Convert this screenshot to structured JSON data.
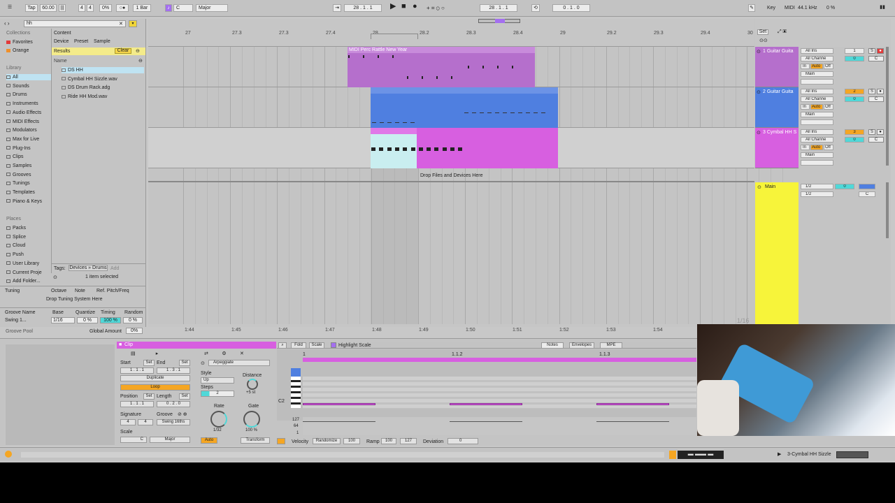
{
  "control_bar": {
    "tap": "Tap",
    "tempo": "60.00",
    "meter_num": "4",
    "meter_den": "4",
    "swing": "0%",
    "quantize": "1 Bar",
    "key": "C",
    "scale": "Major",
    "position": "28 . 1 . 1",
    "loop_start": "28 . 1 . 1",
    "loop_length": "0 . 1 . 0",
    "key_label": "Key",
    "midi_label": "MIDI",
    "sample_rate": "44.1 kHz",
    "cpu": "0 %"
  },
  "browser": {
    "search_value": "hh",
    "content_tab": "Content",
    "filters": [
      "Device",
      "Preset",
      "Sample"
    ],
    "results_label": "Results",
    "clear_label": "Clear",
    "name_col": "Name",
    "collections_label": "Collections",
    "collections": [
      {
        "label": "Favorites",
        "color": "#e23a3a"
      },
      {
        "label": "Orange",
        "color": "#f0902a"
      }
    ],
    "library_label": "Library",
    "library": [
      "All",
      "Sounds",
      "Drums",
      "Instruments",
      "Audio Effects",
      "MIDI Effects",
      "Modulators",
      "Max for Live",
      "Plug-Ins",
      "Clips",
      "Samples",
      "Grooves",
      "Tunings",
      "Templates",
      "Piano & Keys"
    ],
    "places_label": "Places",
    "places": [
      "Packs",
      "Splice",
      "Cloud",
      "Push",
      "User Library",
      "Current Proje",
      "Add Folder..."
    ],
    "results": [
      "DS HH",
      "Cymbal HH Sizzle.wav",
      "DS Drum Rack.adg",
      "Ride HH Mod.wav"
    ],
    "tags_label": "Tags:",
    "tags_value": "Devices » Drums",
    "add_label": "Add",
    "selected_info": "1 item selected",
    "tuning_cols": [
      "Tuning",
      "Octave",
      "Note",
      "Ref. Pitch/Freq"
    ],
    "tuning_drop": "Drop Tuning System Here",
    "groove_cols": [
      "Groove Name",
      "Base",
      "Quantize",
      "Timing",
      "Random"
    ],
    "groove_name": "Swing 1...",
    "groove_base": "1/16",
    "groove_quantize": "0 %",
    "groove_timing": "100 %",
    "groove_random": "0 %",
    "global_amount_label": "Global Amount",
    "global_amount": "0%",
    "groove_pool_label": "Groove Pool"
  },
  "arrangement": {
    "ruler_top": [
      "27",
      "27.3",
      "27.3",
      "27.4",
      "28",
      "28.2",
      "28.3",
      "28.4",
      "29",
      "29.2",
      "29.3",
      "29.4",
      "30"
    ],
    "ruler_bottom": [
      "1:44",
      "1:45",
      "1:46",
      "1:47",
      "1:48",
      "1:49",
      "1:50",
      "1:51",
      "1:52",
      "1:53",
      "1:54"
    ],
    "set_label": "Set",
    "clip1_name": "MIDI Perc Rattle New Year",
    "drop_label": "Drop Files and Devices Here",
    "quantize_hint": "1/16",
    "tracks": [
      {
        "name": "1 Guitar Guita",
        "num": "1",
        "color": "#b56fcc",
        "input": "All Ins",
        "channel": "All Channe",
        "out": "Main",
        "vol": "0",
        "pan": "C",
        "in": "In",
        "auto": "Auto",
        "off": "Off"
      },
      {
        "name": "2 Guitar Guita",
        "num": "2",
        "color": "#4f7fe0",
        "input": "All Ins",
        "channel": "All Channe",
        "out": "Main",
        "vol": "0",
        "pan": "C",
        "in": "In",
        "auto": "Auto",
        "off": "Off"
      },
      {
        "name": "3 Cymbal HH S",
        "num": "3",
        "color": "#d75fe0",
        "input": "All Ins",
        "channel": "All Channe",
        "out": "Main",
        "vol": "0",
        "pan": "C",
        "in": "In",
        "auto": "Auto",
        "off": "Off"
      }
    ],
    "main_track": {
      "name": "Main",
      "color": "#f7f43a",
      "a": "1/2",
      "b": "1/2",
      "vol": "0",
      "pan": "C"
    },
    "solo": "S"
  },
  "detail": {
    "clip_label": "Clip",
    "start_label": "Start",
    "end_label": "End",
    "set_label": "Set",
    "start_val": "1 . 1 . 1",
    "end_val": "1 . 3 . 1",
    "duplicate_label": "Duplicate",
    "loop_label": "Loop",
    "position_label": "Position",
    "length_label": "Length",
    "position_val": "1 . 1 . 1",
    "length_val": "0 . 2 . 0",
    "signature_label": "Signature",
    "groove_label": "Groove",
    "sig_num": "4",
    "sig_den": "4",
    "groove_val": "Swing 16ths",
    "scale_label": "Scale",
    "scale_key": "C",
    "scale_mode": "Major",
    "arp_label": "Arpeggiate",
    "style_label": "Style",
    "style_val": "Up",
    "distance_label": "Distance",
    "distance_val": "+5 st",
    "steps_label": "Steps",
    "steps_val": "2",
    "rate_label": "Rate",
    "rate_val": "1/32",
    "gate_label": "Gate",
    "gate_val": "100 %",
    "auto_label": "Auto",
    "transform_label": "Transform",
    "fold_label": "Fold",
    "scale_btn": "Scale",
    "highlight_label": "Highlight Scale",
    "tabs": [
      "Notes",
      "Envelopes",
      "MPE"
    ],
    "editor_ruler": [
      "1",
      "1.1.2",
      "1.1.3"
    ],
    "c2_label": "C2",
    "vel_scale": [
      "127",
      "64",
      "1"
    ],
    "velocity_label": "Velocity",
    "randomize_label": "Randomize",
    "velocity_val": "100",
    "ramp_label": "Ramp",
    "ramp_a": "100",
    "ramp_b": "127",
    "deviation_label": "Deviation",
    "deviation_val": "0"
  },
  "status_bar": {
    "track_name": "3-Cymbal HH Sizzle"
  },
  "colors": {
    "purple": "#b56fcc",
    "blue": "#4f7fe0",
    "magenta": "#d75fe0",
    "yellow": "#f7f43a",
    "cyan": "#4fd8d8",
    "orange": "#f5a623"
  }
}
